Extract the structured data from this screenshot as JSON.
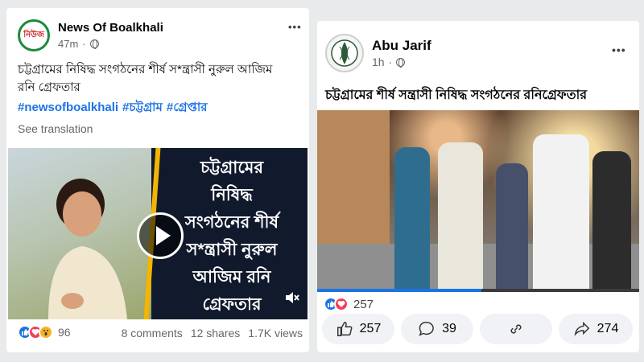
{
  "left_post": {
    "author": "News Of Boalkhali",
    "avatar_text": "নিউজ",
    "time": "47m",
    "more": "•••",
    "text_line1": "চট্টগ্রামের নিষিদ্ধ সংগঠনের শীর্ষ স*ন্ত্রাসী নুরুল আজিম",
    "text_line2": "রনি গ্রেফতার",
    "hashtags": [
      "#newsofboalkhali",
      "#চট্টগ্রাম",
      "#গ্রেপ্তার"
    ],
    "see_translation": "See translation",
    "video_overlay": [
      "চট্টগ্রামের",
      "নিষিদ্ধ",
      "সংগঠনের শীর্ষ",
      "স*ন্ত্রাসী নুরুল",
      "আজিম রনি",
      "গ্রেফতার"
    ],
    "reaction_count": "96",
    "comments": "8 comments",
    "shares": "12 shares",
    "views": "1.7K views"
  },
  "right_post": {
    "author": "Abu Jarif",
    "time": "1h",
    "more": "•••",
    "text": "চট্টগ্রামের শীর্ষ সন্ত্রাসী নিষিদ্ধ সংগঠনের রনিগ্রেফতার",
    "reaction_count": "257",
    "video_progress": 0.51,
    "actions": {
      "like": "257",
      "comment": "39",
      "share": "274"
    }
  },
  "colors": {
    "accent": "#1b74e4",
    "love": "#f33e58",
    "overlay_panel": "#111a2c",
    "highlight_bar": "#f4b400"
  },
  "icons": [
    "globe-icon",
    "play-icon",
    "mute-icon",
    "like-icon",
    "comment-icon",
    "link-icon",
    "share-icon"
  ]
}
